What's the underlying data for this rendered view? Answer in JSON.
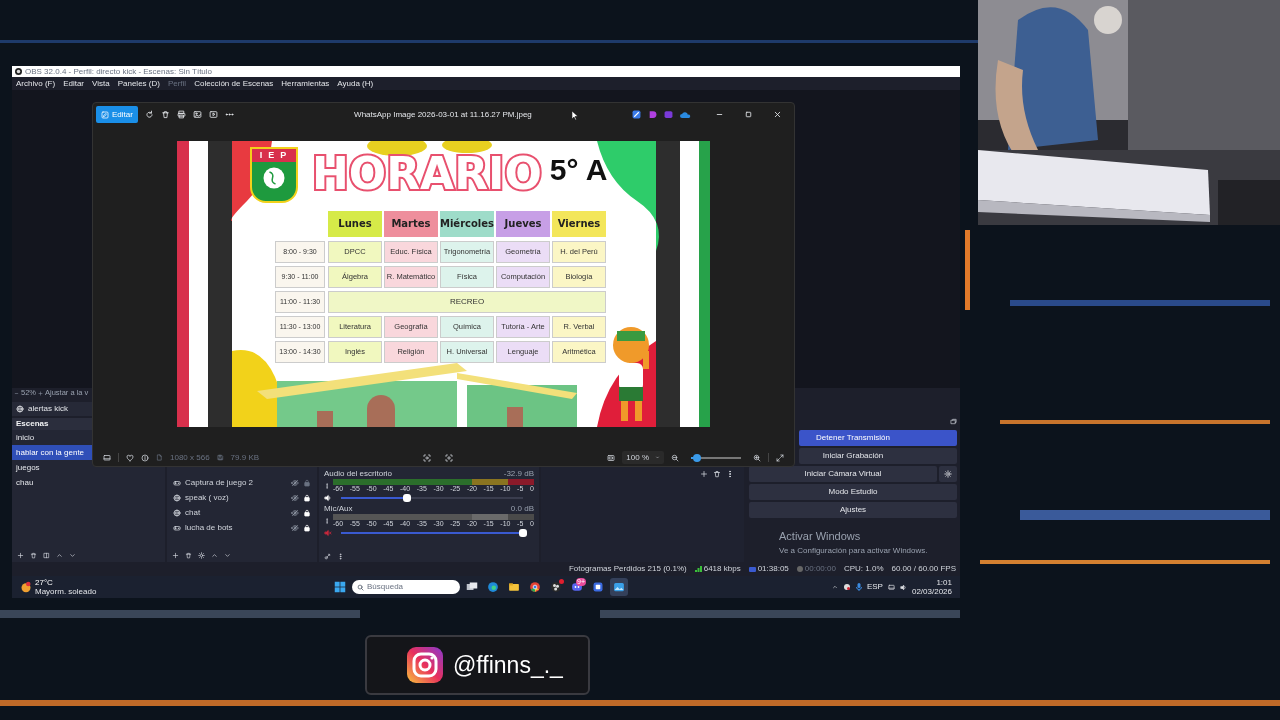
{
  "obs": {
    "title": "OBS 32.0.4 - Perfil: directo kick - Escenas: Sin Título",
    "menu": [
      {
        "label": "Archivo (F)",
        "disabled": false
      },
      {
        "label": "Editar",
        "disabled": false
      },
      {
        "label": "Vista",
        "disabled": false
      },
      {
        "label": "Paneles (D)",
        "disabled": false
      },
      {
        "label": "Perfil",
        "disabled": true
      },
      {
        "label": "Colección de Escenas",
        "disabled": false
      },
      {
        "label": "Herramientas",
        "disabled": false
      },
      {
        "label": "Ayuda (H)",
        "disabled": false
      }
    ],
    "preview_zoom": {
      "value": "52%",
      "fit": "Ajustar a la v"
    },
    "current_source": "alertas kick",
    "scenes": {
      "header": "Escenas",
      "items": [
        {
          "label": "inicio",
          "selected": false
        },
        {
          "label": "hablar con la gente",
          "selected": true
        },
        {
          "label": "juegos",
          "selected": false
        },
        {
          "label": "chau",
          "selected": false
        }
      ]
    },
    "sources": [
      {
        "label": "Captura de juego 2",
        "kind": "game",
        "visible": false,
        "locked": false
      },
      {
        "label": "speak ( voz)",
        "kind": "browser",
        "visible": false,
        "locked": true
      },
      {
        "label": "chat",
        "kind": "browser",
        "visible": false,
        "locked": true
      },
      {
        "label": "lucha de bots",
        "kind": "game",
        "visible": false,
        "locked": true
      }
    ],
    "mixer": [
      {
        "name": "Audio del escritorio",
        "reading": "-32.9 dB",
        "level": 0.36,
        "muted": false,
        "ticks": [
          "-60",
          "-55",
          "-50",
          "-45",
          "-40",
          "-35",
          "-30",
          "-25",
          "-20",
          "-15",
          "-10",
          "-5",
          "0"
        ]
      },
      {
        "name": "Mic/Aux",
        "reading": "0.0 dB",
        "level": 1,
        "muted": true,
        "ticks": [
          "-60",
          "-55",
          "-50",
          "-45",
          "-40",
          "-35",
          "-30",
          "-25",
          "-20",
          "-15",
          "-10",
          "-5",
          "0"
        ]
      }
    ],
    "controls": [
      {
        "label": "Detener Transmisión",
        "active": true,
        "kind": "plain"
      },
      {
        "label": "Iniciar Grabación",
        "active": false,
        "kind": "plain"
      },
      {
        "label": "Iniciar Cámara Virtual",
        "active": false,
        "kind": "with_settings"
      },
      {
        "label": "Modo Estudio",
        "active": false,
        "kind": "plain"
      },
      {
        "label": "Ajustes",
        "active": false,
        "kind": "plain"
      }
    ],
    "activation": {
      "title": "Activar Windows",
      "text": "Ve a Configuración para activar Windows."
    },
    "status_bar": {
      "dropped": "Fotogramas Perdidos 215 (0.1%)",
      "bitrate": "6418 kbps",
      "stream_time": "01:38:05",
      "record_time": "00:00:00",
      "cpu": "CPU: 1.0%",
      "fps": "60.00 / 60.00 FPS"
    }
  },
  "taskbar": {
    "weather": {
      "temp": "27°C",
      "text": "Mayorm. soleado"
    },
    "search": {
      "placeholder": "Búsqueda"
    },
    "apps": [
      {
        "kind": "taskview",
        "selected": false,
        "alert": false
      },
      {
        "kind": "edge",
        "selected": false,
        "alert": false
      },
      {
        "kind": "folder",
        "selected": false,
        "alert": false
      },
      {
        "kind": "chrome",
        "selected": false,
        "alert": false
      },
      {
        "kind": "obs",
        "selected": false,
        "alert": true
      },
      {
        "kind": "discord",
        "selected": false,
        "alert": false,
        "badge": "9+"
      },
      {
        "kind": "app",
        "selected": false,
        "alert": false
      },
      {
        "kind": "photos",
        "selected": true,
        "alert": false
      }
    ],
    "language": "ESP",
    "time": "1:01",
    "date": "02/03/2026"
  },
  "viewer": {
    "edit_label": "Editar",
    "title": "WhatsApp Image 2026-03-01 at 11.16.27 PM.jpeg",
    "dimensions": "1080 x 566",
    "file_size": "79.9 KB",
    "zoom": "100 %",
    "zoom_slider": {
      "level": 0.12
    }
  },
  "schedule": {
    "school": "IEP",
    "title": "HORARIO",
    "grade": "5° A",
    "days": [
      {
        "label": "Lunes",
        "color": "#d6ea48"
      },
      {
        "label": "Martes",
        "color": "#ee8e9c"
      },
      {
        "label": "Miércoles",
        "color": "#9edcc9"
      },
      {
        "label": "Jueves",
        "color": "#c79fe6"
      },
      {
        "label": "Viernes",
        "color": "#f3e65a"
      }
    ],
    "rows": [
      {
        "kind": "lessons",
        "time": "8:00 - 9:30",
        "cells": [
          "DPCC",
          "Educ. Física",
          "Trigonometría",
          "Geometría",
          "H. del Perú"
        ]
      },
      {
        "kind": "lessons",
        "time": "9:30 - 11:00",
        "cells": [
          "Álgebra",
          "R. Matemático",
          "Física",
          "Computación",
          "Biología"
        ]
      },
      {
        "kind": "break",
        "time": "11:00 - 11:30",
        "label": "RECREO"
      },
      {
        "kind": "lessons",
        "time": "11:30 - 13:00",
        "cells": [
          "Literatura",
          "Geografía",
          "Química",
          "Tutoría - Arte",
          "R. Verbal"
        ]
      },
      {
        "kind": "lessons",
        "time": "13:00 - 14:30",
        "cells": [
          "Inglés",
          "Religión",
          "H. Universal",
          "Lenguaje",
          "Aritmética"
        ]
      }
    ]
  },
  "overlay": {
    "handle": "@ffinns_._"
  }
}
